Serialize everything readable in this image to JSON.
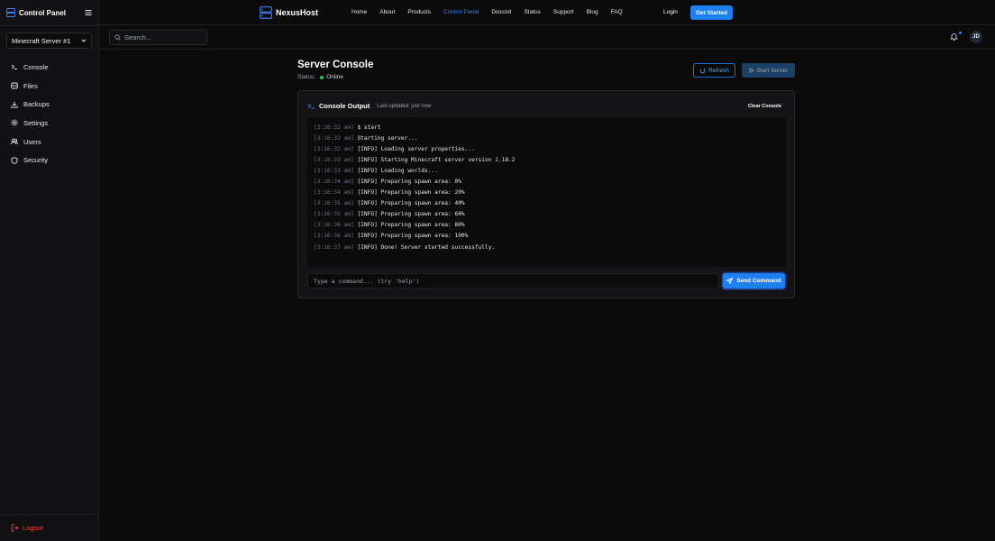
{
  "sidebar": {
    "title": "Control Panel",
    "server_select": "Minecraft Server #1",
    "items": [
      {
        "label": "Console",
        "icon": "terminal-icon"
      },
      {
        "label": "Files",
        "icon": "database-icon"
      },
      {
        "label": "Backups",
        "icon": "download-icon"
      },
      {
        "label": "Settings",
        "icon": "gear-icon"
      },
      {
        "label": "Users",
        "icon": "users-icon"
      },
      {
        "label": "Security",
        "icon": "shield-icon"
      }
    ],
    "logout_label": "Logout"
  },
  "topnav": {
    "brand": "NexusHost",
    "links": [
      "Home",
      "About",
      "Products",
      "Control Panel",
      "Discord",
      "Status",
      "Support",
      "Blog",
      "FAQ"
    ],
    "active_link": "Control Panel",
    "login_label": "Login",
    "get_started_label": "Get Started"
  },
  "search": {
    "placeholder": "Search..."
  },
  "user": {
    "initials": "JD"
  },
  "main": {
    "title": "Server Console",
    "status_label": "Status:",
    "status_value": "Online",
    "refresh_label": "Refresh",
    "start_label": "Start Server"
  },
  "console": {
    "title": "Console Output",
    "last_updated": "Last updated: just now",
    "clear_label": "Clear Console",
    "lines": [
      {
        "ts": "[3:16:32 am]",
        "msg": "$ start"
      },
      {
        "ts": "[3:16:32 am]",
        "msg": "Starting server..."
      },
      {
        "ts": "[3:16:32 am]",
        "msg": "[INFO] Loading server properties..."
      },
      {
        "ts": "[3:16:33 am]",
        "msg": "[INFO] Starting Minecraft server version 1.18.2"
      },
      {
        "ts": "[3:16:33 am]",
        "msg": "[INFO] Loading worlds..."
      },
      {
        "ts": "[3:16:34 am]",
        "msg": "[INFO] Preparing spawn area: 0%"
      },
      {
        "ts": "[3:16:34 am]",
        "msg": "[INFO] Preparing spawn area: 20%"
      },
      {
        "ts": "[3:16:35 am]",
        "msg": "[INFO] Preparing spawn area: 40%"
      },
      {
        "ts": "[3:16:35 am]",
        "msg": "[INFO] Preparing spawn area: 60%"
      },
      {
        "ts": "[3:16:36 am]",
        "msg": "[INFO] Preparing spawn area: 80%"
      },
      {
        "ts": "[3:16:36 am]",
        "msg": "[INFO] Preparing spawn area: 100%"
      },
      {
        "ts": "[3:16:37 am]",
        "msg": "[INFO] Done! Server started successfully."
      }
    ],
    "input_placeholder": "Type a command... (try 'help')",
    "send_label": "Send Command"
  },
  "colors": {
    "accent": "#1d7ff0",
    "link_active": "#3b82f6",
    "online": "#22c55e",
    "logout": "#ef4444",
    "background": "#0b0b0c"
  }
}
